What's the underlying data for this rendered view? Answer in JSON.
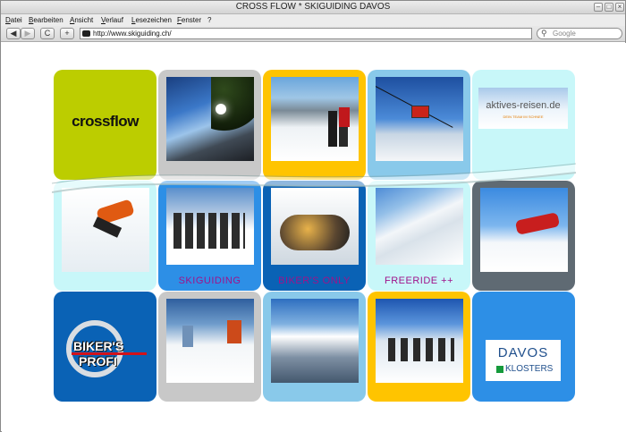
{
  "window": {
    "title": "CROSS FLOW * SKIGUIDING DAVOS"
  },
  "menu": [
    "Datei",
    "Bearbeiten",
    "Ansicht",
    "Verlauf",
    "Lesezeichen",
    "Fenster",
    "?"
  ],
  "toolbar": {
    "back": "◀",
    "forward": "▶",
    "reload": "C",
    "new_tab": "+",
    "url": "http://www.skiguiding.ch/",
    "search_placeholder": "Google"
  },
  "tiles": {
    "crossflow_logo": "crossflow",
    "aktives_reisen_logo": "aktives-reisen.de",
    "aktives_reisen_tagline": "DEIN TEAM IM SCHNEE",
    "skiguiding": "SKIGUIDING",
    "bikers_only": "BIKER'S ONLY",
    "freeride": "FREERIDE ++",
    "bikers_profi_line1": "BIKER'S",
    "bikers_profi_line2": "PROFI",
    "davos_line1": "DAVOS",
    "davos_line2": "KLOSTERS"
  },
  "colors": {
    "lime": "#bccd00",
    "grey": "#c8c8c8",
    "gold": "#ffc400",
    "sky": "#89c9ea",
    "ice": "#c8f7f9",
    "blue": "#2d8fe6",
    "darkblue": "#0a62b5",
    "slate": "#5f6a73",
    "caption": "#a0138a"
  }
}
